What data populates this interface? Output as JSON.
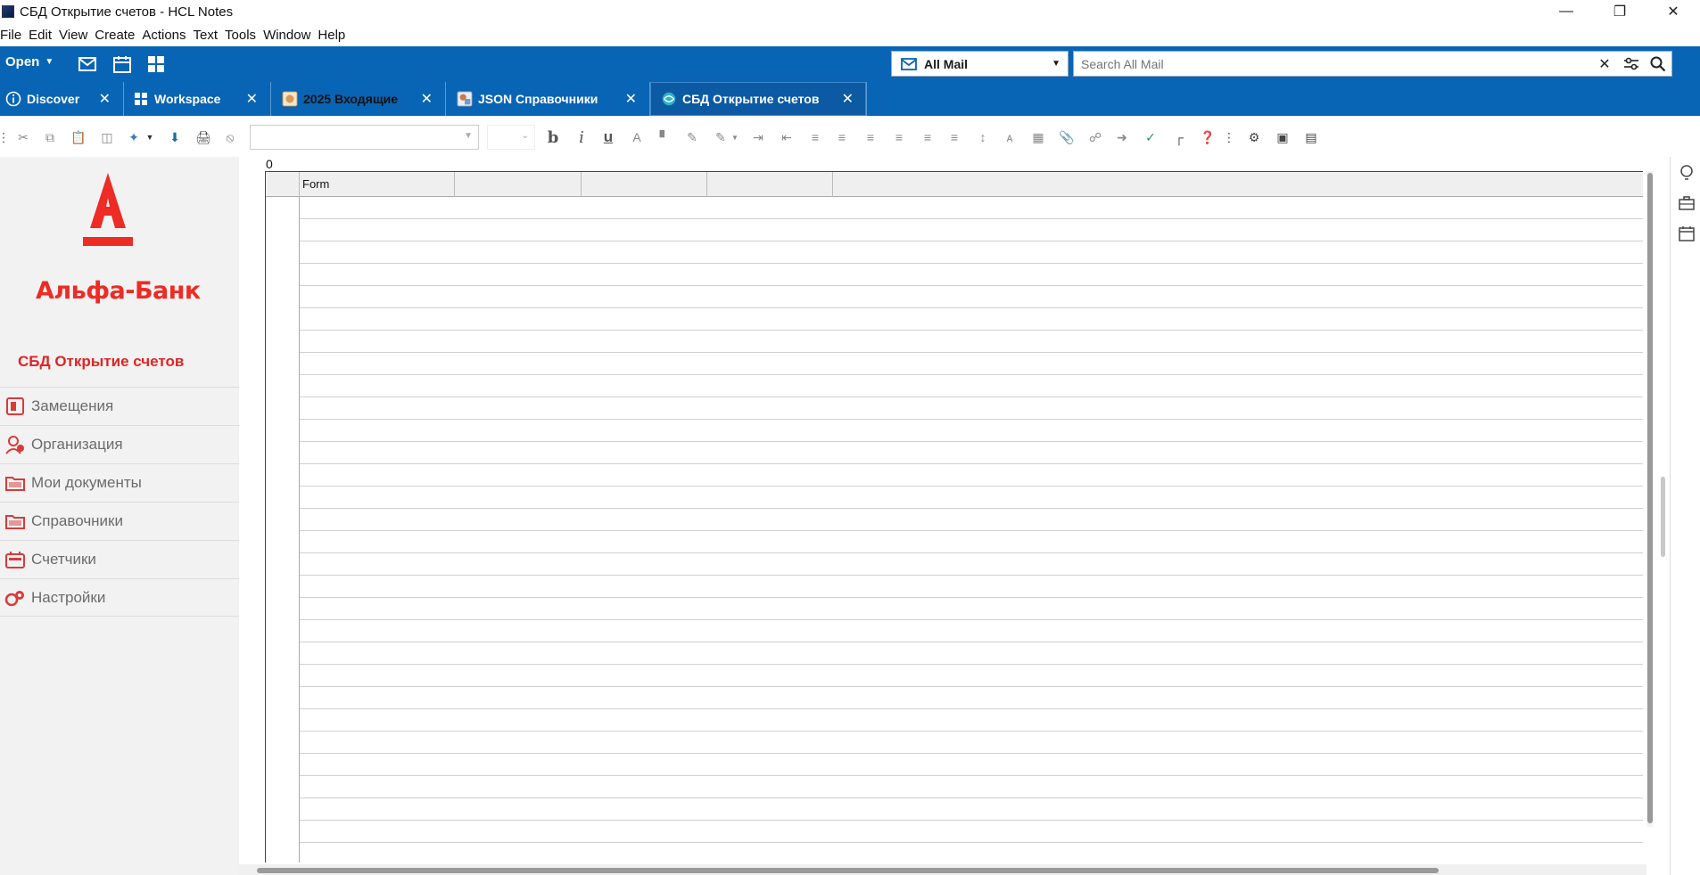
{
  "window": {
    "title": "СБД Открытие счетов - HCL Notes",
    "controls": [
      "minimize-icon",
      "restore-icon",
      "close-icon"
    ]
  },
  "menu": [
    "File",
    "Edit",
    "View",
    "Create",
    "Actions",
    "Text",
    "Tools",
    "Window",
    "Help"
  ],
  "toolbar": {
    "open_label": "Open",
    "mail_scope": "All Mail",
    "search_placeholder": "Search All Mail"
  },
  "tabs": [
    {
      "label": "Discover",
      "icon": "info-icon"
    },
    {
      "label": "Workspace",
      "icon": "grid-icon"
    },
    {
      "label": "2025 Входящие",
      "icon": "db-icon"
    },
    {
      "label": "JSON Справочники",
      "icon": "db-icon"
    },
    {
      "label": "СБД Открытие счетов",
      "icon": "db-icon",
      "active": true
    }
  ],
  "sidebar": {
    "brand": "Альфа-Банк",
    "db_title": "СБД Открытие счетов",
    "items": [
      {
        "label": "Замещения",
        "icon": "substitution-icon"
      },
      {
        "label": "Организация",
        "icon": "organization-icon"
      },
      {
        "label": "Мои документы",
        "icon": "folder-icon"
      },
      {
        "label": "Справочники",
        "icon": "folder-icon"
      },
      {
        "label": "Счетчики",
        "icon": "counter-icon"
      },
      {
        "label": "Настройки",
        "icon": "settings-icon"
      }
    ]
  },
  "view": {
    "count_label": "0",
    "columns": [
      "Form",
      "",
      "",
      ""
    ]
  },
  "colors": {
    "brand_blue": "#0864b5",
    "alfa_red": "#ee2b24"
  }
}
